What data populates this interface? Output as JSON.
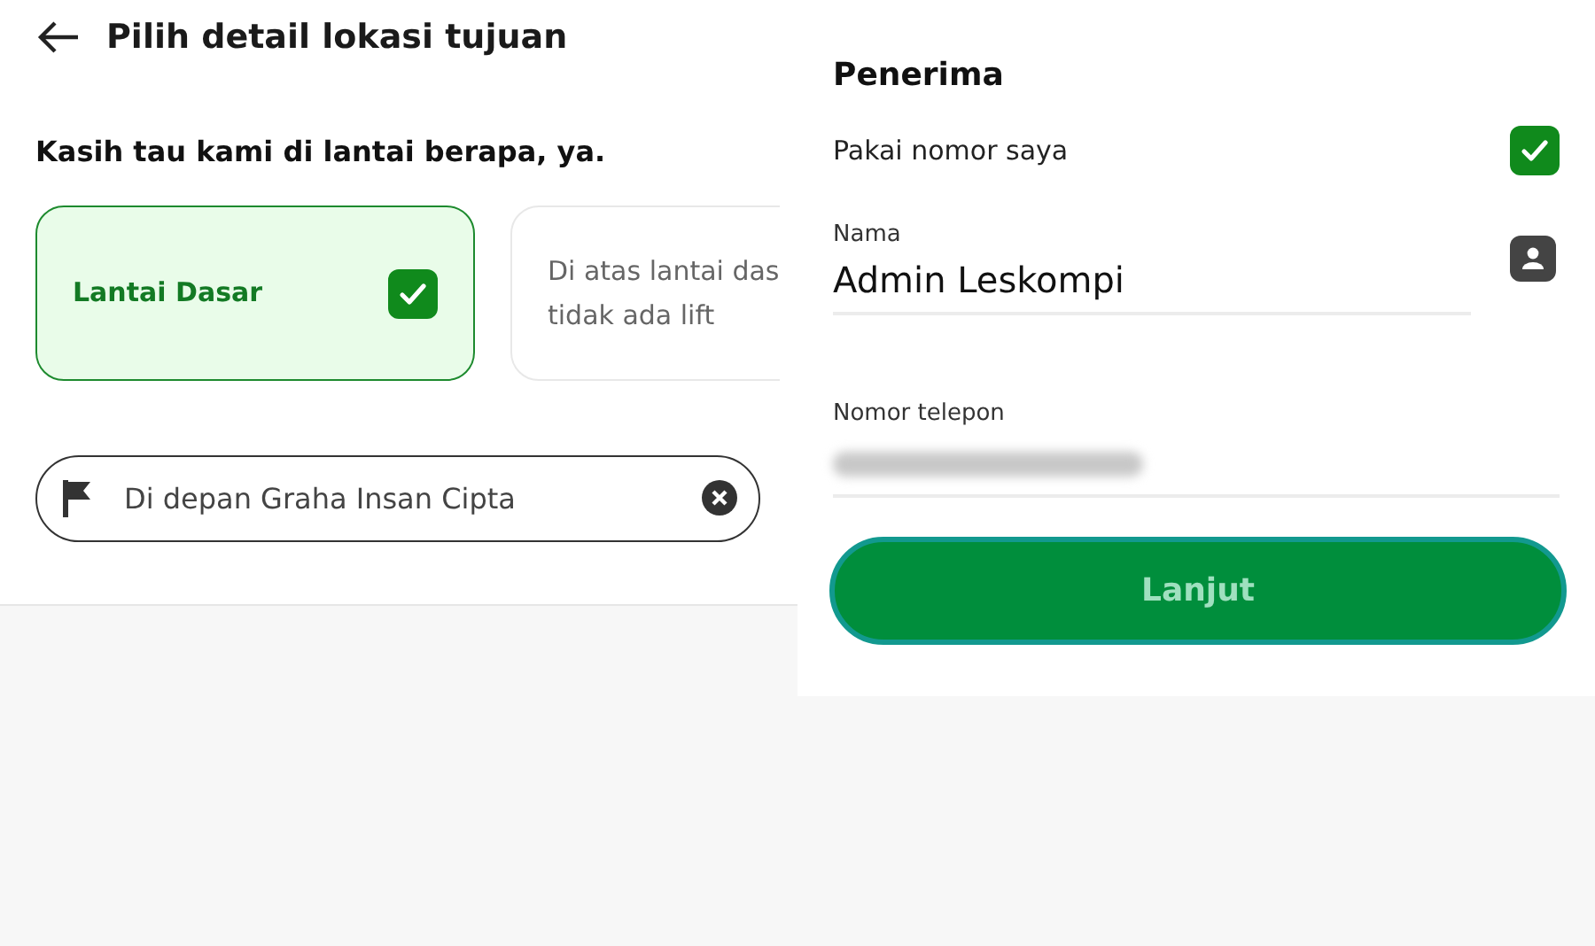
{
  "left": {
    "title": "Pilih detail lokasi tujuan",
    "question": "Kasih tau kami di lantai berapa, ya.",
    "options": [
      {
        "label": "Lantai Dasar",
        "selected": true
      },
      {
        "label": "Di atas lantai das\ntidak ada lift",
        "selected": false
      }
    ],
    "note_field": {
      "value": "Di depan Graha Insan Cipta"
    }
  },
  "right": {
    "section_title": "Penerima",
    "use_my_number": {
      "label": "Pakai nomor saya",
      "checked": true
    },
    "name_field": {
      "label": "Nama",
      "value": "Admin Leskompi"
    },
    "phone_field": {
      "label": "Nomor telepon"
    },
    "button": "Lanjut"
  }
}
